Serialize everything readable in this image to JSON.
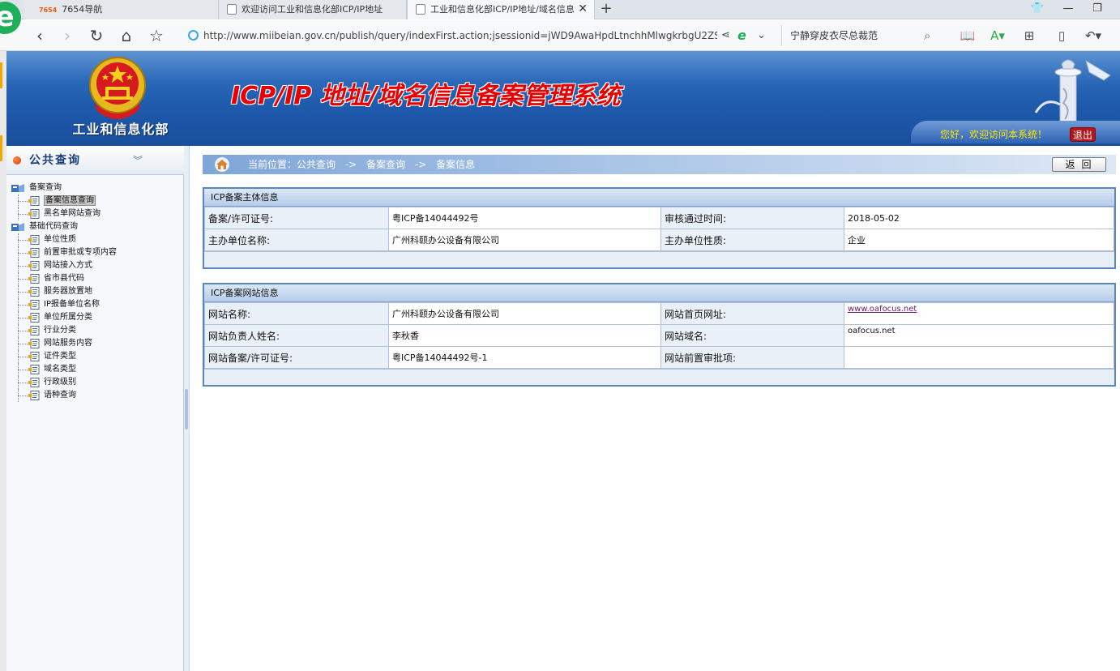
{
  "browser": {
    "logo": "e",
    "tabs": [
      {
        "label": "7654导航",
        "num": "7654"
      },
      {
        "label": "欢迎访问工业和信息化部ICP/IP地址"
      },
      {
        "label": "工业和信息化部ICP/IP地址/域名信息"
      }
    ],
    "new_tab": "+",
    "address": "http://www.miibeian.gov.cn/publish/query/indexFirst.action;jsessionid=jWD9AwaHpdLtnchhMlwgkrbgU2ZS×",
    "search_text": "宁静穿皮衣尽总裁范"
  },
  "header": {
    "ministry_name": "工业和信息化部",
    "system_title": "ICP/IP 地址/域名信息备案管理系统",
    "welcome": "您好，欢迎访问本系统！",
    "logout": "退出"
  },
  "sidebar": {
    "title": "公共查询",
    "groups": [
      {
        "label": "备案查询",
        "items": [
          {
            "label": "备案信息查询",
            "selected": true
          },
          {
            "label": "黑名单网站查询"
          }
        ]
      },
      {
        "label": "基础代码查询",
        "items": [
          {
            "label": "单位性质"
          },
          {
            "label": "前置审批或专项内容"
          },
          {
            "label": "网站接入方式"
          },
          {
            "label": "省市县代码"
          },
          {
            "label": "服务器放置地"
          },
          {
            "label": "IP报备单位名称"
          },
          {
            "label": "单位所属分类"
          },
          {
            "label": "行业分类"
          },
          {
            "label": "网站服务内容"
          },
          {
            "label": "证件类型"
          },
          {
            "label": "域名类型"
          },
          {
            "label": "行政级别"
          },
          {
            "label": "语种查询"
          }
        ]
      }
    ]
  },
  "breadcrumb": {
    "prefix": "当前位置：公共查询",
    "sep": "->",
    "level2": "备案查询",
    "level3": "备案信息"
  },
  "back_button": "返回",
  "entity_panel": {
    "title": "ICP备案主体信息",
    "rows": [
      {
        "label1": "备案/许可证号:",
        "value1": "粤ICP备14044492号",
        "label2": "审核通过时间:",
        "value2": "2018-05-02"
      },
      {
        "label1": "主办单位名称:",
        "value1": "广州科颐办公设备有限公司",
        "label2": "主办单位性质:",
        "value2": "企业"
      }
    ]
  },
  "site_panel": {
    "title": "ICP备案网站信息",
    "rows": [
      {
        "label1": "网站名称:",
        "value1": "广州科颐办公设备有限公司",
        "label2": "网站首页网址:",
        "value2": "www.oafocus.net"
      },
      {
        "label1": "网站负责人姓名:",
        "value1": "李秋香",
        "label2": "网站域名:",
        "value2": "oafocus.net"
      },
      {
        "label1": "网站备案/许可证号:",
        "value1": "粤ICP备14044492号-1",
        "label2": "网站前置审批项:",
        "value2": ""
      }
    ]
  },
  "colors": {
    "header_blue": "#1f5bad",
    "title_red": "#e60000",
    "welcome_yellow": "#ffe600",
    "logout_red": "#b5141a",
    "panel_border": "#5a86bd"
  }
}
